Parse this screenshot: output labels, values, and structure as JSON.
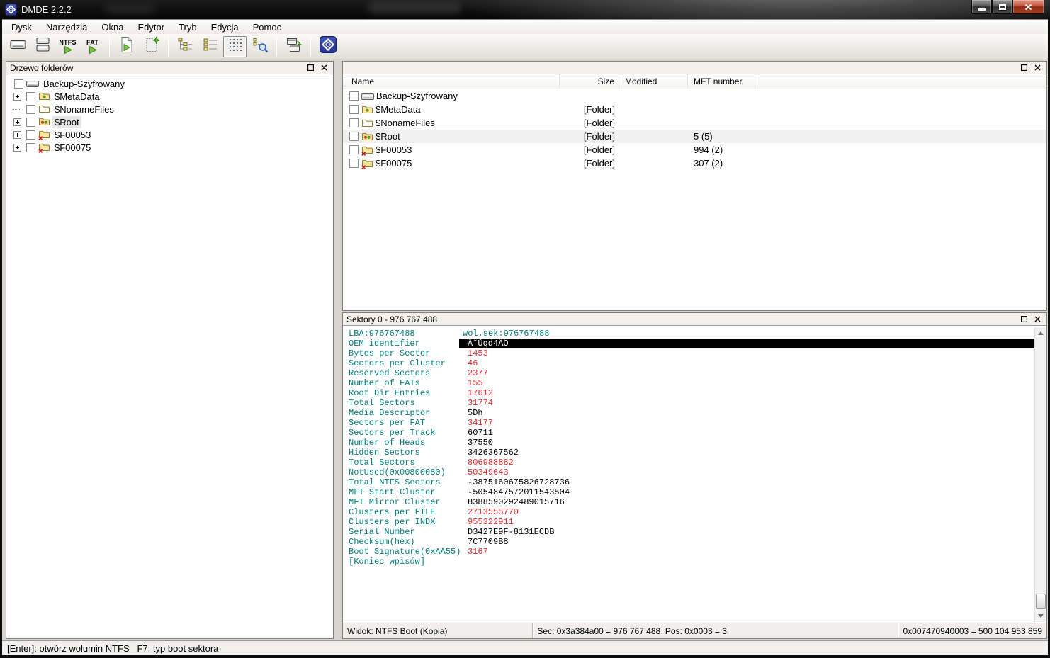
{
  "window": {
    "title": "DMDE 2.2.2"
  },
  "titlebar_controls": [
    {
      "name": "minimize-button",
      "glyph": "min"
    },
    {
      "name": "maximize-button",
      "glyph": "max"
    },
    {
      "name": "close-button",
      "glyph": "close"
    }
  ],
  "menu_bar": {
    "items": [
      "Dysk",
      "Narzędzia",
      "Okna",
      "Edytor",
      "Tryb",
      "Edycja",
      "Pomoc"
    ]
  },
  "toolbar": {
    "buttons": [
      {
        "name": "open-disk-button",
        "icon": "drive"
      },
      {
        "name": "select-device-button",
        "icon": "drives"
      },
      {
        "name": "ntfs-volume-button",
        "icon": "fs",
        "label": "NTFS"
      },
      {
        "name": "fat-volume-button",
        "icon": "fs",
        "label": "FAT"
      },
      {
        "separator": true
      },
      {
        "name": "open-volume-button",
        "icon": "doc-play"
      },
      {
        "name": "new-scan-button",
        "icon": "doc-new"
      },
      {
        "separator": true
      },
      {
        "name": "tree-view-button",
        "icon": "tree-view"
      },
      {
        "name": "list-view-button",
        "icon": "list-view"
      },
      {
        "name": "table-view-button",
        "icon": "table-view",
        "active": true
      },
      {
        "name": "search-view-button",
        "icon": "search-view"
      },
      {
        "separator": true
      },
      {
        "name": "window-panels-button",
        "icon": "windows"
      },
      {
        "separator": true
      },
      {
        "name": "dmde-logo-button",
        "icon": "dmde-logo"
      }
    ]
  },
  "folder_tree_panel": {
    "title": "Drzewo folderów",
    "items": [
      {
        "label": "Backup-Szyfrowany",
        "icon": "drive",
        "level": 0,
        "expander": "none",
        "selected": false
      },
      {
        "label": "$MetaData",
        "icon": "folder-dot",
        "level": 1,
        "expander": "plus",
        "selected": false
      },
      {
        "label": "$NonameFiles",
        "icon": "folder-open",
        "level": 1,
        "expander": "line",
        "selected": false
      },
      {
        "label": "$Root",
        "icon": "folder-dots",
        "level": 1,
        "expander": "plus",
        "selected": true
      },
      {
        "label": "$F00053",
        "icon": "folder-x",
        "level": 1,
        "expander": "plus",
        "selected": false
      },
      {
        "label": "$F00075",
        "icon": "folder-x",
        "level": 1,
        "expander": "plus",
        "selected": false
      }
    ]
  },
  "file_panel": {
    "columns": [
      "Name",
      "Size",
      "Modified",
      "MFT number"
    ],
    "rows": [
      {
        "name": "Backup-Szyfrowany",
        "icon": "drive",
        "size": "",
        "modified": "",
        "mft": "",
        "selected": false
      },
      {
        "name": "$MetaData",
        "icon": "folder-dot",
        "size": "[Folder]",
        "modified": "",
        "mft": "",
        "selected": false
      },
      {
        "name": "$NonameFiles",
        "icon": "folder-open",
        "size": "[Folder]",
        "modified": "",
        "mft": "",
        "selected": false
      },
      {
        "name": "$Root",
        "icon": "folder-dots",
        "size": "[Folder]",
        "modified": "",
        "mft": "5 (5)",
        "selected": true
      },
      {
        "name": "$F00053",
        "icon": "folder-x",
        "size": "[Folder]",
        "modified": "",
        "mft": "994 (2)",
        "selected": false
      },
      {
        "name": "$F00075",
        "icon": "folder-x",
        "size": "[Folder]",
        "modified": "",
        "mft": "307 (2)",
        "selected": false
      }
    ]
  },
  "sector_panel": {
    "title": "Sektory 0 - 976 767 488",
    "top_line": {
      "left": "LBA:976767488",
      "right": "wol.sek:976767488"
    },
    "fields": [
      {
        "label": "OEM identifier",
        "value": "Ä˘Ůqd4ÄÔ",
        "style": "sel"
      },
      {
        "label": "Bytes per Sector",
        "value": "1453",
        "style": "red"
      },
      {
        "label": "Sectors per Cluster",
        "value": "46",
        "style": "red"
      },
      {
        "label": "Reserved Sectors",
        "value": "2377",
        "style": "red"
      },
      {
        "label": "Number of FATs",
        "value": "155",
        "style": "red"
      },
      {
        "label": "Root Dir Entries",
        "value": "17612",
        "style": "red"
      },
      {
        "label": "Total Sectors",
        "value": "31774",
        "style": "red"
      },
      {
        "label": "Media Descriptor",
        "value": "5Dh",
        "style": "blk"
      },
      {
        "label": "Sectors per FAT",
        "value": "34177",
        "style": "red"
      },
      {
        "label": "Sectors per Track",
        "value": "60711",
        "style": "blk"
      },
      {
        "label": "Number of Heads",
        "value": "37550",
        "style": "blk"
      },
      {
        "label": "Hidden Sectors",
        "value": "3426367562",
        "style": "blk"
      },
      {
        "label": "Total Sectors",
        "value": "806988882",
        "style": "red"
      },
      {
        "label": "NotUsed(0x00800080)",
        "value": "50349643",
        "style": "red"
      },
      {
        "label": "Total NTFS Sectors",
        "value": "-3875160675826728736",
        "style": "blk"
      },
      {
        "label": "MFT Start Cluster",
        "value": "-5054847572011543504",
        "style": "blk"
      },
      {
        "label": "MFT Mirror Cluster",
        "value": "8388590292489015716",
        "style": "blk"
      },
      {
        "label": "Clusters per FILE",
        "value": "2713555770",
        "style": "red"
      },
      {
        "label": "Clusters per INDX",
        "value": "955322911",
        "style": "red"
      },
      {
        "label": "Serial Number",
        "value": "D3427E9F-8131ECDB",
        "style": "blk"
      },
      {
        "label": "Checksum(hex)",
        "value": "7C7709B8",
        "style": "blk"
      },
      {
        "label": "Boot Signature(0xAA55)",
        "value": "3167",
        "style": "red"
      }
    ],
    "end_marker": "[Koniec wpisów]",
    "status_cells": [
      "Widok: NTFS Boot (Kopia)",
      "Sec: 0x3a384a00 = 976 767 488  Pos: 0x0003 = 3",
      "0x007470940003 = 500 104 953 859"
    ]
  },
  "status_bar": {
    "text": "[Enter]: otwórz wolumin NTFS   F7: typ boot sektora"
  },
  "colors": {
    "field_label_teal": "#007d7d",
    "field_value_red": "#dd2c2c",
    "highlight_bg": "#000000",
    "highlight_fg": "#ffffff",
    "logo_blue": "#2b3a9e"
  }
}
